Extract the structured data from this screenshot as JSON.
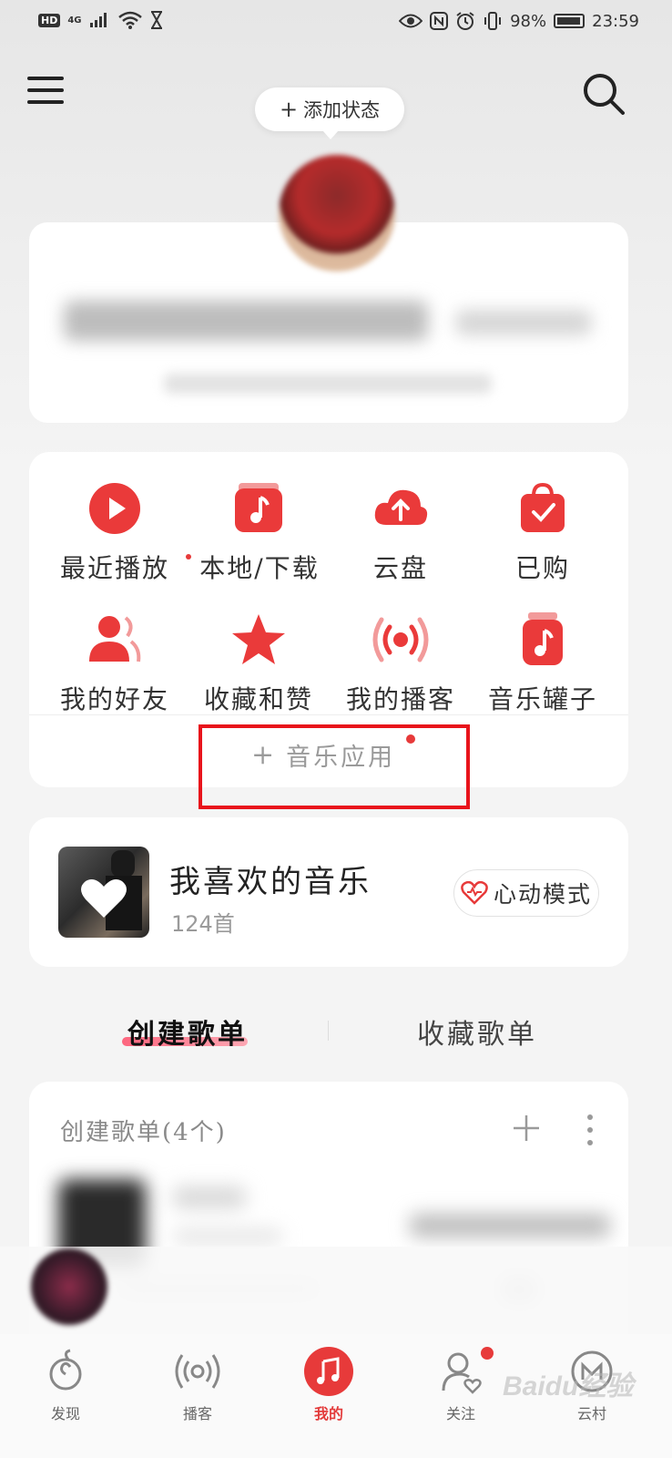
{
  "status_bar": {
    "hd": "HD",
    "signal": "4G",
    "battery": "98%",
    "time": "23:59"
  },
  "header": {
    "add_status_plus": "+",
    "add_status_label": "添加状态"
  },
  "functions": [
    {
      "label": "最近播放",
      "icon": "play-circle-icon"
    },
    {
      "label": "本地/下载",
      "icon": "music-note-box-icon"
    },
    {
      "label": "云盘",
      "icon": "cloud-upload-icon"
    },
    {
      "label": "已购",
      "icon": "shopping-bag-check-icon"
    },
    {
      "label": "我的好友",
      "icon": "friends-icon"
    },
    {
      "label": "收藏和赞",
      "icon": "star-icon"
    },
    {
      "label": "我的播客",
      "icon": "broadcast-icon"
    },
    {
      "label": "音乐罐子",
      "icon": "music-jar-icon"
    }
  ],
  "music_apps": {
    "plus": "+",
    "label": "音乐应用"
  },
  "liked": {
    "title": "我喜欢的音乐",
    "count": "124首",
    "heartbeat_label": "心动模式"
  },
  "tabs": {
    "created": "创建歌单",
    "favorited": "收藏歌单"
  },
  "playlists": {
    "header": "创建歌单(4个)"
  },
  "nav": [
    {
      "label": "发现",
      "icon": "discover-icon"
    },
    {
      "label": "播客",
      "icon": "podcast-icon"
    },
    {
      "label": "我的",
      "icon": "music-note-icon",
      "active": true
    },
    {
      "label": "关注",
      "icon": "follow-icon"
    },
    {
      "label": "云村",
      "icon": "cloud-village-icon"
    }
  ],
  "watermark": "Baidu经验",
  "colors": {
    "accent": "#e73a3a",
    "highlight": "#e8131b"
  }
}
